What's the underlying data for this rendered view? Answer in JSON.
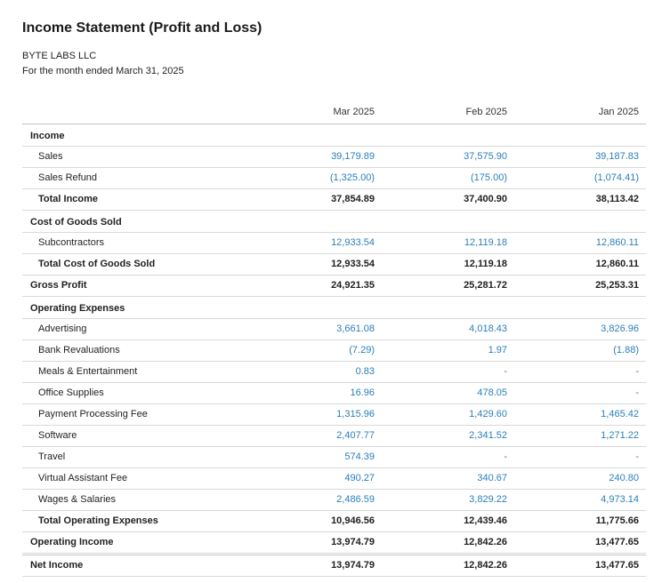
{
  "report": {
    "title": "Income Statement (Profit and Loss)",
    "company": "BYTE LABS LLC",
    "period": "For the month ended March 31, 2025",
    "columns": [
      "Mar 2025",
      "Feb 2025",
      "Jan 2025"
    ]
  },
  "rows": [
    {
      "type": "section",
      "label": "Income",
      "values": [
        "",
        "",
        ""
      ]
    },
    {
      "type": "item",
      "label": "Sales",
      "values": [
        "39,179.89",
        "37,575.90",
        "39,187.83"
      ]
    },
    {
      "type": "item",
      "label": "Sales Refund",
      "values": [
        "(1,325.00)",
        "(175.00)",
        "(1,074.41)"
      ]
    },
    {
      "type": "total1",
      "label": "Total Income",
      "values": [
        "37,854.89",
        "37,400.90",
        "38,113.42"
      ]
    },
    {
      "type": "section",
      "label": "Cost of Goods Sold",
      "values": [
        "",
        "",
        ""
      ]
    },
    {
      "type": "item",
      "label": "Subcontractors",
      "values": [
        "12,933.54",
        "12,119.18",
        "12,860.11"
      ]
    },
    {
      "type": "total1",
      "label": "Total Cost of Goods Sold",
      "values": [
        "12,933.54",
        "12,119.18",
        "12,860.11"
      ]
    },
    {
      "type": "total0",
      "label": "Gross Profit",
      "values": [
        "24,921.35",
        "25,281.72",
        "25,253.31"
      ]
    },
    {
      "type": "section",
      "label": "Operating Expenses",
      "values": [
        "",
        "",
        ""
      ]
    },
    {
      "type": "item",
      "label": "Advertising",
      "values": [
        "3,661.08",
        "4,018.43",
        "3,826.96"
      ]
    },
    {
      "type": "item",
      "label": "Bank Revaluations",
      "values": [
        "(7.29)",
        "1.97",
        "(1.88)"
      ]
    },
    {
      "type": "item",
      "label": "Meals & Entertainment",
      "values": [
        "0.83",
        "-",
        "-"
      ]
    },
    {
      "type": "item",
      "label": "Office Supplies",
      "values": [
        "16.96",
        "478.05",
        "-"
      ]
    },
    {
      "type": "item",
      "label": "Payment Processing Fee",
      "values": [
        "1,315.96",
        "1,429.60",
        "1,465.42"
      ]
    },
    {
      "type": "item",
      "label": "Software",
      "values": [
        "2,407.77",
        "2,341.52",
        "1,271.22"
      ]
    },
    {
      "type": "item",
      "label": "Travel",
      "values": [
        "574.39",
        "-",
        "-"
      ]
    },
    {
      "type": "item",
      "label": "Virtual Assistant Fee",
      "values": [
        "490.27",
        "340.67",
        "240.80"
      ]
    },
    {
      "type": "item",
      "label": "Wages & Salaries",
      "values": [
        "2,486.59",
        "3,829.22",
        "4,973.14"
      ]
    },
    {
      "type": "total1",
      "label": "Total Operating Expenses",
      "values": [
        "10,946.56",
        "12,439.46",
        "11,775.66"
      ]
    },
    {
      "type": "total0",
      "label": "Operating Income",
      "values": [
        "13,974.79",
        "12,842.26",
        "13,477.65"
      ]
    },
    {
      "type": "net",
      "label": "Net Income",
      "values": [
        "13,974.79",
        "12,842.26",
        "13,477.65"
      ]
    }
  ]
}
